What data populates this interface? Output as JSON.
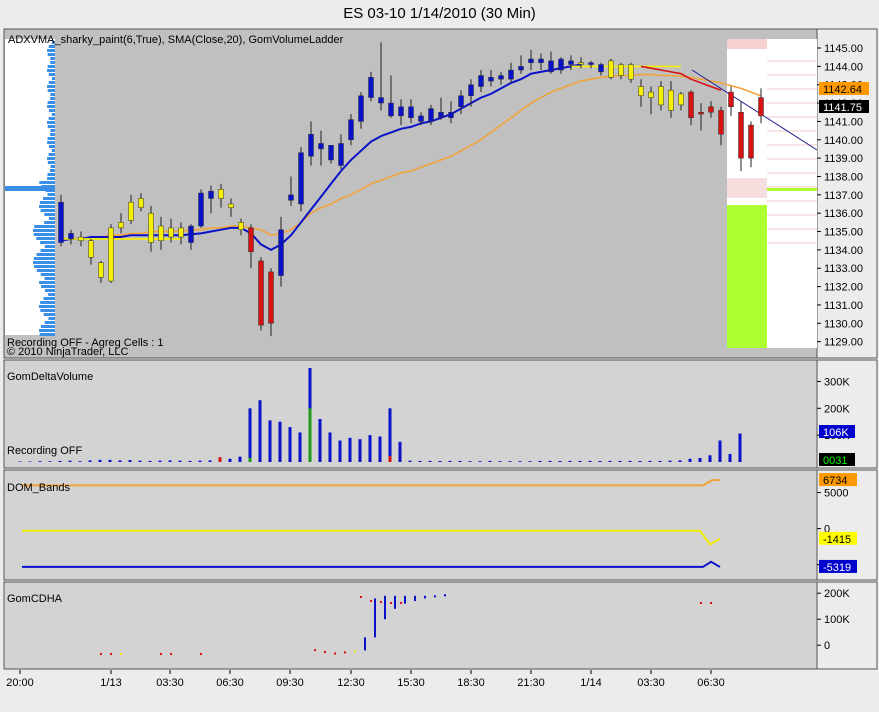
{
  "title": "ES 03-10  1/14/2010 (30 Min)",
  "panels": {
    "price": {
      "indicator_label": "ADXVMA_sharky_paint(6,True), SMA(Close,20), GomVolumeLadder",
      "recording_text": "Recording OFF - Agreg Cells : 1",
      "copyright": "© 2010 NinjaTrader, LLC",
      "tags": [
        {
          "value": "1142.64",
          "bg": "#ff9900",
          "fg": "#000000"
        },
        {
          "value": "1141.75",
          "bg": "#000000",
          "fg": "#ffffff"
        }
      ]
    },
    "delta": {
      "label": "GomDeltaVolume",
      "recording_text": "Recording OFF",
      "tags": [
        {
          "value": "106K",
          "bg": "#0000cc",
          "fg": "#ffffff"
        },
        {
          "value": "0031",
          "bg": "#000000",
          "fg": "#00ff00"
        }
      ]
    },
    "dom": {
      "label": "DOM_Bands",
      "tags": [
        {
          "value": "6734",
          "bg": "#ff9900",
          "fg": "#000000"
        },
        {
          "value": "-1415",
          "bg": "#ffff00",
          "fg": "#000000"
        },
        {
          "value": "-5319",
          "bg": "#0000cc",
          "fg": "#ffffff"
        }
      ]
    },
    "cdha": {
      "label": "GomCDHA"
    }
  },
  "chart_data": [
    {
      "type": "candlestick",
      "panel": "price",
      "ylim": [
        1128.6,
        1145.6
      ],
      "yticks": [
        "1145.00",
        "1144.00",
        "1143.00",
        "1142.00",
        "1141.00",
        "1140.00",
        "1139.00",
        "1138.00",
        "1137.00",
        "1136.00",
        "1135.00",
        "1134.00",
        "1133.00",
        "1132.00",
        "1131.00",
        "1130.00",
        "1129.00"
      ],
      "x_tick_labels": [
        "20:00",
        "1/13",
        "03:30",
        "06:30",
        "09:30",
        "12:30",
        "15:30",
        "18:30",
        "21:30",
        "1/14",
        "03:30",
        "06:30"
      ],
      "candles": [
        {
          "o": 1134.4,
          "h": 1137.0,
          "l": 1134.2,
          "c": 1136.6,
          "color": "blue"
        },
        {
          "o": 1134.6,
          "h": 1135.1,
          "l": 1134.3,
          "c": 1134.9,
          "color": "blue"
        },
        {
          "o": 1134.7,
          "h": 1135.0,
          "l": 1134.2,
          "c": 1134.5,
          "color": "yellow"
        },
        {
          "o": 1134.5,
          "h": 1134.6,
          "l": 1133.2,
          "c": 1133.6,
          "color": "yellow"
        },
        {
          "o": 1133.3,
          "h": 1133.4,
          "l": 1132.2,
          "c": 1132.5,
          "color": "yellow"
        },
        {
          "o": 1132.3,
          "h": 1135.4,
          "l": 1132.2,
          "c": 1135.2,
          "color": "yellow"
        },
        {
          "o": 1135.2,
          "h": 1136.0,
          "l": 1134.9,
          "c": 1135.5,
          "color": "yellow"
        },
        {
          "o": 1135.6,
          "h": 1137.0,
          "l": 1135.4,
          "c": 1136.6,
          "color": "yellow"
        },
        {
          "o": 1136.8,
          "h": 1137.1,
          "l": 1136.1,
          "c": 1136.3,
          "color": "yellow"
        },
        {
          "o": 1136.0,
          "h": 1136.4,
          "l": 1133.9,
          "c": 1134.4,
          "color": "yellow"
        },
        {
          "o": 1134.5,
          "h": 1135.8,
          "l": 1134.0,
          "c": 1135.3,
          "color": "yellow"
        },
        {
          "o": 1135.2,
          "h": 1135.7,
          "l": 1134.4,
          "c": 1134.7,
          "color": "yellow"
        },
        {
          "o": 1134.7,
          "h": 1135.5,
          "l": 1134.3,
          "c": 1135.2,
          "color": "yellow"
        },
        {
          "o": 1134.4,
          "h": 1135.4,
          "l": 1134.0,
          "c": 1135.3,
          "color": "blue"
        },
        {
          "o": 1135.3,
          "h": 1137.3,
          "l": 1135.2,
          "c": 1137.1,
          "color": "blue"
        },
        {
          "o": 1136.8,
          "h": 1137.5,
          "l": 1136.0,
          "c": 1137.2,
          "color": "blue"
        },
        {
          "o": 1137.3,
          "h": 1137.6,
          "l": 1136.3,
          "c": 1136.8,
          "color": "yellow"
        },
        {
          "o": 1136.5,
          "h": 1136.8,
          "l": 1135.8,
          "c": 1136.3,
          "color": "yellow"
        },
        {
          "o": 1135.5,
          "h": 1135.7,
          "l": 1134.8,
          "c": 1135.1,
          "color": "yellow"
        },
        {
          "o": 1135.2,
          "h": 1135.4,
          "l": 1133.0,
          "c": 1133.9,
          "color": "red"
        },
        {
          "o": 1133.4,
          "h": 1133.6,
          "l": 1129.6,
          "c": 1129.9,
          "color": "red"
        },
        {
          "o": 1132.8,
          "h": 1133.0,
          "l": 1129.3,
          "c": 1130.0,
          "color": "red"
        },
        {
          "o": 1132.6,
          "h": 1135.8,
          "l": 1132.0,
          "c": 1135.1,
          "color": "blue"
        },
        {
          "o": 1136.7,
          "h": 1138.0,
          "l": 1136.4,
          "c": 1137.0,
          "color": "blue"
        },
        {
          "o": 1136.5,
          "h": 1139.6,
          "l": 1136.1,
          "c": 1139.3,
          "color": "blue"
        },
        {
          "o": 1139.1,
          "h": 1141.0,
          "l": 1138.6,
          "c": 1140.3,
          "color": "blue"
        },
        {
          "o": 1139.8,
          "h": 1140.5,
          "l": 1138.6,
          "c": 1139.5,
          "color": "blue"
        },
        {
          "o": 1138.9,
          "h": 1139.7,
          "l": 1138.7,
          "c": 1139.7,
          "color": "blue"
        },
        {
          "o": 1138.6,
          "h": 1140.3,
          "l": 1138.4,
          "c": 1139.8,
          "color": "blue"
        },
        {
          "o": 1140.0,
          "h": 1141.4,
          "l": 1139.7,
          "c": 1141.1,
          "color": "blue"
        },
        {
          "o": 1141.0,
          "h": 1142.6,
          "l": 1140.6,
          "c": 1142.4,
          "color": "blue"
        },
        {
          "o": 1142.3,
          "h": 1143.7,
          "l": 1142.1,
          "c": 1143.4,
          "color": "blue"
        },
        {
          "o": 1142.3,
          "h": 1145.3,
          "l": 1141.6,
          "c": 1142.0,
          "color": "blue"
        },
        {
          "o": 1142.0,
          "h": 1143.5,
          "l": 1141.2,
          "c": 1141.3,
          "color": "blue"
        },
        {
          "o": 1141.3,
          "h": 1142.2,
          "l": 1140.8,
          "c": 1141.8,
          "color": "blue"
        },
        {
          "o": 1141.2,
          "h": 1142.2,
          "l": 1140.9,
          "c": 1141.8,
          "color": "blue"
        },
        {
          "o": 1141.3,
          "h": 1141.5,
          "l": 1140.8,
          "c": 1141.0,
          "color": "blue"
        },
        {
          "o": 1141.0,
          "h": 1141.9,
          "l": 1140.8,
          "c": 1141.7,
          "color": "blue"
        },
        {
          "o": 1141.5,
          "h": 1142.3,
          "l": 1141.1,
          "c": 1141.2,
          "color": "blue"
        },
        {
          "o": 1141.2,
          "h": 1142.1,
          "l": 1140.9,
          "c": 1141.5,
          "color": "blue"
        },
        {
          "o": 1141.8,
          "h": 1142.7,
          "l": 1141.4,
          "c": 1142.4,
          "color": "blue"
        },
        {
          "o": 1142.4,
          "h": 1143.3,
          "l": 1141.8,
          "c": 1143.0,
          "color": "blue"
        },
        {
          "o": 1142.9,
          "h": 1143.8,
          "l": 1142.6,
          "c": 1143.5,
          "color": "blue"
        },
        {
          "o": 1143.2,
          "h": 1143.8,
          "l": 1142.9,
          "c": 1143.4,
          "color": "blue"
        },
        {
          "o": 1143.5,
          "h": 1143.7,
          "l": 1143.0,
          "c": 1143.3,
          "color": "blue"
        },
        {
          "o": 1143.3,
          "h": 1144.2,
          "l": 1143.1,
          "c": 1143.8,
          "color": "blue"
        },
        {
          "o": 1143.8,
          "h": 1144.6,
          "l": 1143.6,
          "c": 1144.0,
          "color": "blue"
        },
        {
          "o": 1144.2,
          "h": 1144.9,
          "l": 1143.8,
          "c": 1144.4,
          "color": "blue"
        },
        {
          "o": 1144.2,
          "h": 1144.7,
          "l": 1143.8,
          "c": 1144.4,
          "color": "blue"
        },
        {
          "o": 1144.3,
          "h": 1144.8,
          "l": 1143.6,
          "c": 1143.7,
          "color": "blue"
        },
        {
          "o": 1143.8,
          "h": 1144.5,
          "l": 1143.6,
          "c": 1144.4,
          "color": "blue"
        },
        {
          "o": 1144.1,
          "h": 1144.6,
          "l": 1143.8,
          "c": 1144.3,
          "color": "blue"
        },
        {
          "o": 1144.2,
          "h": 1144.5,
          "l": 1143.9,
          "c": 1144.2,
          "color": "yellow"
        },
        {
          "o": 1144.2,
          "h": 1144.3,
          "l": 1143.9,
          "c": 1144.1,
          "color": "blue"
        },
        {
          "o": 1143.7,
          "h": 1144.2,
          "l": 1143.5,
          "c": 1144.1,
          "color": "blue"
        },
        {
          "o": 1144.3,
          "h": 1144.4,
          "l": 1143.3,
          "c": 1143.4,
          "color": "yellow"
        },
        {
          "o": 1143.5,
          "h": 1144.2,
          "l": 1143.3,
          "c": 1144.1,
          "color": "yellow"
        },
        {
          "o": 1144.1,
          "h": 1144.2,
          "l": 1143.1,
          "c": 1143.3,
          "color": "yellow"
        },
        {
          "o": 1142.9,
          "h": 1143.3,
          "l": 1141.8,
          "c": 1142.4,
          "color": "yellow"
        },
        {
          "o": 1142.6,
          "h": 1142.9,
          "l": 1141.4,
          "c": 1142.3,
          "color": "yellow"
        },
        {
          "o": 1142.9,
          "h": 1143.2,
          "l": 1141.6,
          "c": 1141.9,
          "color": "yellow"
        },
        {
          "o": 1142.7,
          "h": 1143.2,
          "l": 1141.2,
          "c": 1141.6,
          "color": "yellow"
        },
        {
          "o": 1141.9,
          "h": 1142.6,
          "l": 1141.6,
          "c": 1142.5,
          "color": "yellow"
        },
        {
          "o": 1142.6,
          "h": 1142.7,
          "l": 1140.8,
          "c": 1141.2,
          "color": "red"
        },
        {
          "o": 1141.4,
          "h": 1142.0,
          "l": 1140.5,
          "c": 1141.5,
          "color": "red"
        },
        {
          "o": 1141.8,
          "h": 1142.1,
          "l": 1141.2,
          "c": 1141.5,
          "color": "red"
        },
        {
          "o": 1141.6,
          "h": 1141.8,
          "l": 1139.7,
          "c": 1140.3,
          "color": "red"
        },
        {
          "o": 1142.6,
          "h": 1142.9,
          "l": 1141.3,
          "c": 1141.8,
          "color": "red"
        },
        {
          "o": 1141.5,
          "h": 1142.1,
          "l": 1138.3,
          "c": 1139.0,
          "color": "red"
        },
        {
          "o": 1140.8,
          "h": 1141.0,
          "l": 1138.5,
          "c": 1139.0,
          "color": "red"
        },
        {
          "o": 1142.3,
          "h": 1142.8,
          "l": 1140.9,
          "c": 1141.3,
          "color": "red"
        }
      ],
      "lines": [
        {
          "color": "orange",
          "values": [
            1134.5,
            1134.6,
            1134.6,
            1134.7,
            1134.7,
            1134.8,
            1134.8,
            1134.9,
            1134.9,
            1135.0,
            1135.0,
            1135.0,
            1135.0,
            1135.1,
            1135.1,
            1135.2,
            1135.2,
            1135.3,
            1135.3,
            1135.2,
            1135.1,
            1134.8,
            1134.9,
            1135.1,
            1135.5,
            1136.0,
            1136.3,
            1136.5,
            1136.8,
            1137.0,
            1137.3,
            1137.6,
            1137.8,
            1138.0,
            1138.2,
            1138.3,
            1138.5,
            1138.7,
            1138.9,
            1139.1,
            1139.4,
            1139.7,
            1140.0,
            1140.4,
            1140.8,
            1141.2,
            1141.6,
            1142.0,
            1142.3,
            1142.6,
            1142.8,
            1143.0,
            1143.2,
            1143.3,
            1143.4,
            1143.45,
            1143.5,
            1143.5,
            1143.55,
            1143.55,
            1143.5,
            1143.5,
            1143.45,
            1143.4,
            1143.3,
            1143.2,
            1143.1,
            1142.95,
            1142.8,
            1142.6,
            1142.4
          ]
        },
        {
          "color": "blue",
          "values": [
            1134.5,
            1134.6,
            1134.6,
            1134.7,
            1134.7,
            1134.7,
            1134.7,
            1134.8,
            1134.8,
            1134.8,
            1134.8,
            1134.8,
            1134.8,
            1134.85,
            1134.9,
            1135.0,
            1135.1,
            1135.2,
            1135.2,
            1134.9,
            1134.3,
            1134.0,
            1134.3,
            1134.8,
            1135.5,
            1136.2,
            1136.9,
            1137.6,
            1138.3,
            1138.9,
            1139.4,
            1139.9,
            1140.2,
            1140.4,
            1140.6,
            1140.7,
            1140.9,
            1141.0,
            1141.2,
            1141.4,
            1141.7,
            1142.0,
            1142.3,
            1142.5,
            1142.8,
            1143.1,
            1143.3,
            1143.6,
            1143.7,
            1143.8,
            1143.9,
            1144.0,
            1144.1
          ]
        },
        {
          "color": "yellow",
          "values": [
            1134.6,
            1134.6,
            1134.6,
            1134.6,
            1134.6,
            1134.6,
            1134.6,
            1134.6,
            1134.6,
            1134.6,
            1134.6,
            1134.6,
            1134.6
          ]
        },
        {
          "color": "yellow",
          "values": [
            1144.0,
            1144.0,
            1144.0,
            1144.0,
            1144.0,
            1144.0,
            1144.0,
            1144.0,
            1144.0,
            1144.0,
            1144.0,
            1144.0
          ]
        },
        {
          "color": "red",
          "values": [
            1144.0,
            1143.9,
            1143.8,
            1143.7,
            1143.6,
            1143.3,
            1143.1,
            1142.9,
            1142.7
          ]
        }
      ]
    },
    {
      "type": "bar",
      "panel": "delta",
      "ylim": [
        0,
        350000
      ],
      "yticks": [
        "300K",
        "200K",
        "100K"
      ],
      "values": [
        2000,
        2000,
        3000,
        3000,
        4000,
        5000,
        3000,
        6000,
        8000,
        8000,
        6000,
        7000,
        5000,
        4000,
        5000,
        6000,
        5000,
        4000,
        5000,
        6000,
        8000,
        12000,
        20000,
        200000,
        230000,
        155000,
        150000,
        130000,
        110000,
        350000,
        160000,
        110000,
        80000,
        90000,
        85000,
        100000,
        95000,
        200000,
        75000,
        5000,
        4000,
        4000,
        4000,
        4000,
        4000,
        3000,
        3000,
        4000,
        3000,
        3000,
        3000,
        3000,
        4000,
        4000,
        4000,
        4000,
        4000,
        4000,
        4000,
        4000,
        4000,
        4000,
        4000,
        4000,
        4000,
        5000,
        6000,
        12000,
        15000,
        25000,
        80000,
        30000,
        106000
      ],
      "greens": {
        "29": 200000,
        "23": 15000
      },
      "reds": {
        "20": 18000,
        "37": 22000
      }
    },
    {
      "type": "line",
      "panel": "dom",
      "yticks": [
        "5000",
        "0",
        "-5000"
      ],
      "ylim": [
        -6300,
        7300
      ],
      "series": [
        {
          "color": "orange",
          "values": [
            6000,
            6734
          ]
        },
        {
          "color": "yellow",
          "values": [
            -300,
            -1415
          ]
        },
        {
          "color": "blue",
          "values": [
            -5319,
            -5319
          ]
        }
      ]
    },
    {
      "type": "bar",
      "panel": "cdha",
      "ylim": [
        -80000,
        220000
      ],
      "yticks": [
        "200K",
        "100K",
        "0"
      ],
      "bars": [
        {
          "i": 23,
          "lo": -20000,
          "hi": -15000,
          "color": "red"
        },
        {
          "i": 24,
          "lo": -30000,
          "hi": -22000,
          "color": "red"
        },
        {
          "i": 25,
          "lo": -35000,
          "hi": -28000,
          "color": "red"
        },
        {
          "i": 26,
          "lo": -30000,
          "hi": -24000,
          "color": "red"
        },
        {
          "i": 27,
          "lo": -25000,
          "hi": -20000,
          "color": "yellow"
        },
        {
          "i": 28,
          "lo": -20000,
          "hi": 30000,
          "color": "blue"
        },
        {
          "i": 29,
          "lo": 30000,
          "hi": 180000,
          "color": "blue"
        },
        {
          "i": 30,
          "lo": 100000,
          "hi": 190000,
          "color": "blue"
        },
        {
          "i": 31,
          "lo": 140000,
          "hi": 190000,
          "color": "blue"
        },
        {
          "i": 32,
          "lo": 160000,
          "hi": 190000,
          "color": "blue"
        },
        {
          "i": 33,
          "lo": 170000,
          "hi": 190000,
          "color": "blue"
        },
        {
          "i": 34,
          "lo": 180000,
          "hi": 190000,
          "color": "blue"
        },
        {
          "i": 35,
          "lo": 185000,
          "hi": 192000,
          "color": "blue"
        },
        {
          "i": 36,
          "lo": 188000,
          "hi": 196000,
          "color": "blue"
        }
      ]
    }
  ]
}
